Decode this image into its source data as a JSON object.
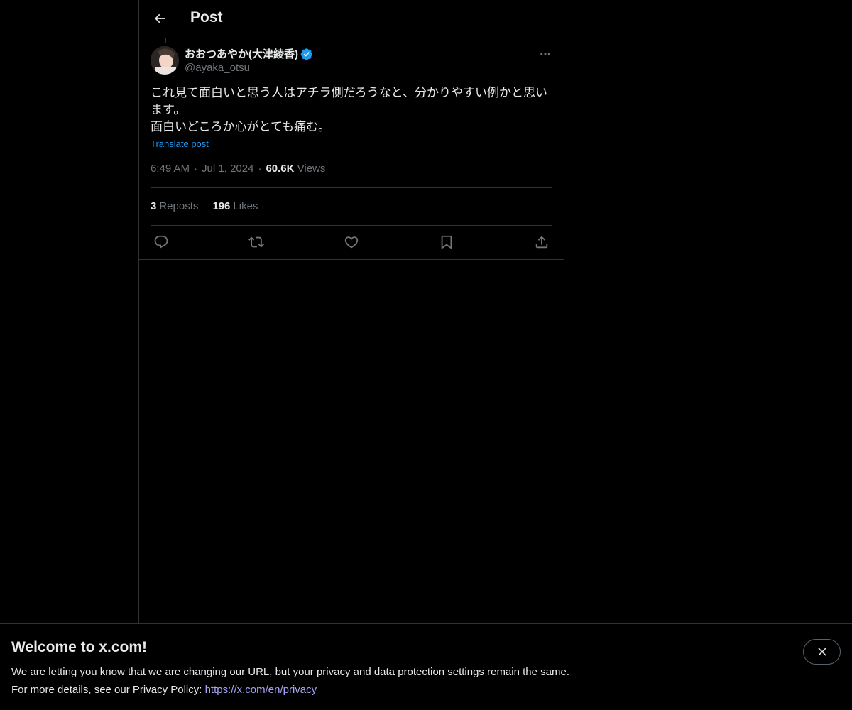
{
  "header": {
    "title": "Post"
  },
  "author": {
    "display_name": "おおつあやか(大津綾香)",
    "handle": "@ayaka_otsu",
    "verified_color": "#1d9bf0"
  },
  "post": {
    "text": "これ見て面白いと思う人はアチラ側だろうなと、分かりやすい例かと思います。\n面白いどころか心がとても痛む。",
    "translate_label": "Translate post",
    "time": "6:49 AM",
    "separator": "·",
    "date": "Jul 1, 2024",
    "views_count": "60.6K",
    "views_label": "Views"
  },
  "stats": {
    "reposts_count": "3",
    "reposts_label": "Reposts",
    "likes_count": "196",
    "likes_label": "Likes"
  },
  "actions": [
    "reply-icon",
    "repost-icon",
    "like-icon",
    "bookmark-icon",
    "share-icon"
  ],
  "banner": {
    "title": "Welcome to x.com!",
    "line1": "We are letting you know that we are changing our URL, but your privacy and data protection settings remain the same.",
    "line2_prefix": "For more details, see our Privacy Policy: ",
    "link": "https://x.com/en/privacy"
  },
  "colors": {
    "background": "#000000",
    "text": "#e7e9ea",
    "muted": "#71767b",
    "accent": "#1d9bf0",
    "border": "#2f3336"
  }
}
